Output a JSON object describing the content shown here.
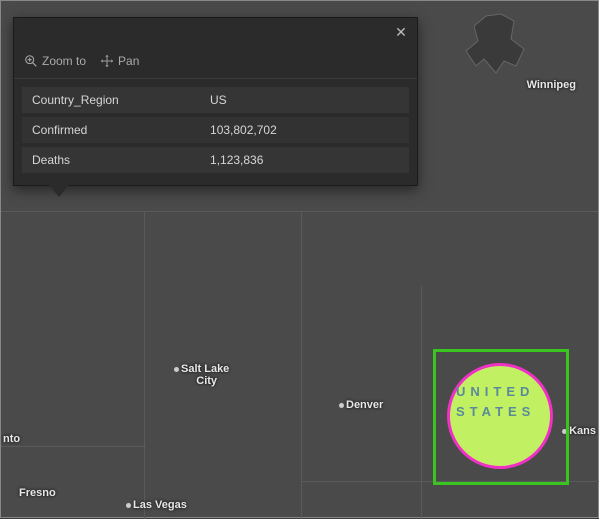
{
  "popup": {
    "close_glyph": "✕",
    "tools": {
      "zoom_label": "Zoom to",
      "pan_label": "Pan"
    },
    "rows": [
      {
        "key": "Country_Region",
        "value": "US"
      },
      {
        "key": "Confirmed",
        "value": "103,802,702"
      },
      {
        "key": "Deaths",
        "value": "1,123,836"
      }
    ]
  },
  "cities": {
    "winnipeg": "Winnipeg",
    "slc_line1": "Salt Lake",
    "slc_line2": "City",
    "denver": "Denver",
    "kansas": "Kans",
    "fresno": "Fresno",
    "vegas": "Las Vegas",
    "nto": "nto"
  },
  "country_label_line1": "UNITED",
  "country_label_line2": "STATES",
  "highlight_color": "#39c41f",
  "bubble_fill": "#ccff66",
  "bubble_stroke": "#ff2ed1"
}
